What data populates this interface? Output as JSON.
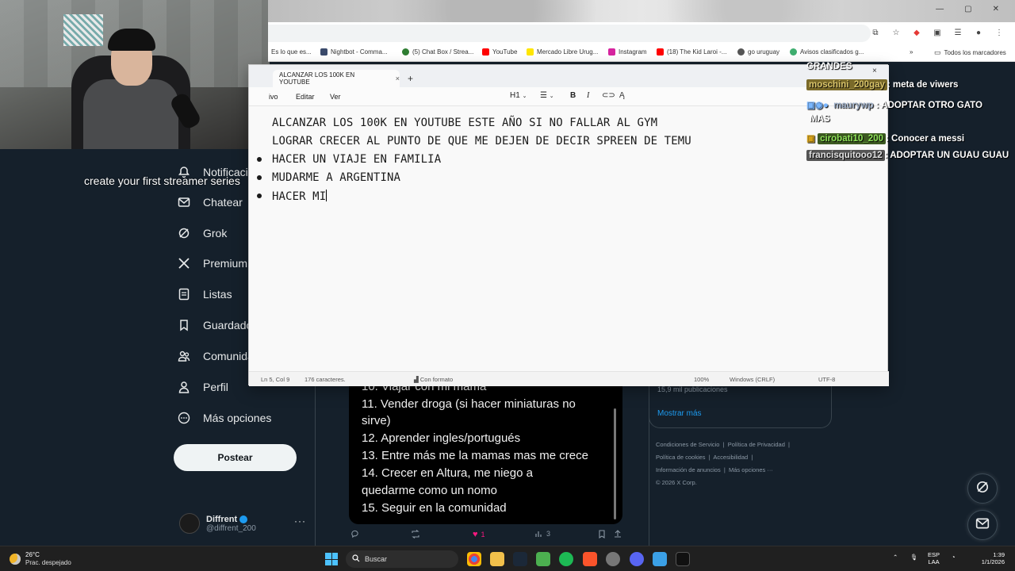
{
  "webcam": {
    "label": ""
  },
  "caption": "create your first streamer series",
  "browser": {
    "bookmarks": [
      "Es lo que es...",
      "Nightbot - Comma...",
      "(5) Chat Box / Strea...",
      "YouTube",
      "Mercado Libre Urug...",
      "Instagram",
      "(18) The Kid Laroi -...",
      "go uruguay",
      "Avisos clasificados g..."
    ],
    "bookmarks_more": "»",
    "all_bookmarks": "Todos los marcadores",
    "window_controls": [
      "—",
      "▢",
      "✕"
    ]
  },
  "notepad": {
    "tab_title": "ALCANZAR LOS 100K EN YOUTUBE",
    "tab_close": "×",
    "new_tab": "+",
    "menu": [
      "ivo",
      "Editar",
      "Ver"
    ],
    "format": {
      "heading": "H1",
      "bold": "B",
      "italic": "I"
    },
    "lines": [
      "ALCANZAR LOS 100K EN YOUTUBE ESTE AÑO SI NO FALLAR AL GYM",
      "LOGRAR CRECER AL PUNTO DE QUE ME DEJEN DE DECIR SPREEN DE TEMU",
      "HACER UN VIAJE EN FAMILIA",
      "MUDARME A ARGENTINA",
      "HACER MI"
    ],
    "status": {
      "position": "Ln 5, Col 9",
      "chars": "176 caracteres.",
      "format": "Con formato",
      "zoom": "100%",
      "line_ending": "Windows (CRLF)",
      "encoding": "UTF-8"
    }
  },
  "chat": {
    "close": "×",
    "messages": [
      {
        "user": "GRANDES",
        "text": ""
      },
      {
        "user": "moschini_200gay",
        "text": ": meta de viwers",
        "user_color": "#c9b24a"
      },
      {
        "user": "maurywp",
        "text": ": ADOPTAR OTRO GATO",
        "user_color": "#9fb0c8",
        "cont": "MAS"
      },
      {
        "user": "cirobati10_200",
        "text": ": Conocer a messi",
        "user_color": "#7ed957"
      },
      {
        "user": "francisquitooo12",
        "text": ": ADOPTAR UN GUAU GUAU",
        "user_color": "#cfd8dc"
      }
    ]
  },
  "x": {
    "nav": [
      {
        "label": "Notificaciones",
        "icon": "bell-icon"
      },
      {
        "label": "Chatear",
        "icon": "mail-icon"
      },
      {
        "label": "Grok",
        "icon": "grok-icon"
      },
      {
        "label": "Premium",
        "icon": "x-logo-icon"
      },
      {
        "label": "Listas",
        "icon": "list-icon"
      },
      {
        "label": "Guardados",
        "icon": "bookmark-icon"
      },
      {
        "label": "Comunidades",
        "icon": "people-icon"
      },
      {
        "label": "Perfil",
        "icon": "person-icon"
      },
      {
        "label": "Más opciones",
        "icon": "more-circle-icon"
      }
    ],
    "post_button": "Postear",
    "profile": {
      "name": "Diffrent",
      "handle": "@diffrent_200",
      "more": "···"
    },
    "tweet_lines": [
      "10. Viajar con mi mamá",
      "11. Vender droga (si hacer miniaturas no",
      "sirve)",
      "12. Aprender ingles/portugués",
      "13. Entre más me la mamas mas me crece",
      "14. Crecer en Altura, me niego a",
      "quedarme como un nomo",
      "15. Seguir en la comunidad"
    ],
    "tweet_actions": {
      "likes": "1",
      "views": "3"
    },
    "right_box": {
      "publications": "15,9 mil publicaciones",
      "show_more": "Mostrar más"
    },
    "footer": [
      [
        "Condiciones de Servicio",
        "Política de Privacidad"
      ],
      [
        "Política de cookies",
        "Accesibilidad"
      ],
      [
        "Información de anuncios",
        "Más opciones ···"
      ],
      [
        "© 2026 X Corp."
      ]
    ]
  },
  "taskbar": {
    "temperature": "26°C",
    "condition": "Prac. despejado",
    "search": "Buscar",
    "lang_top": "ESP",
    "lang_bottom": "LAA",
    "time": "1:39",
    "date": "1/1/2026"
  }
}
